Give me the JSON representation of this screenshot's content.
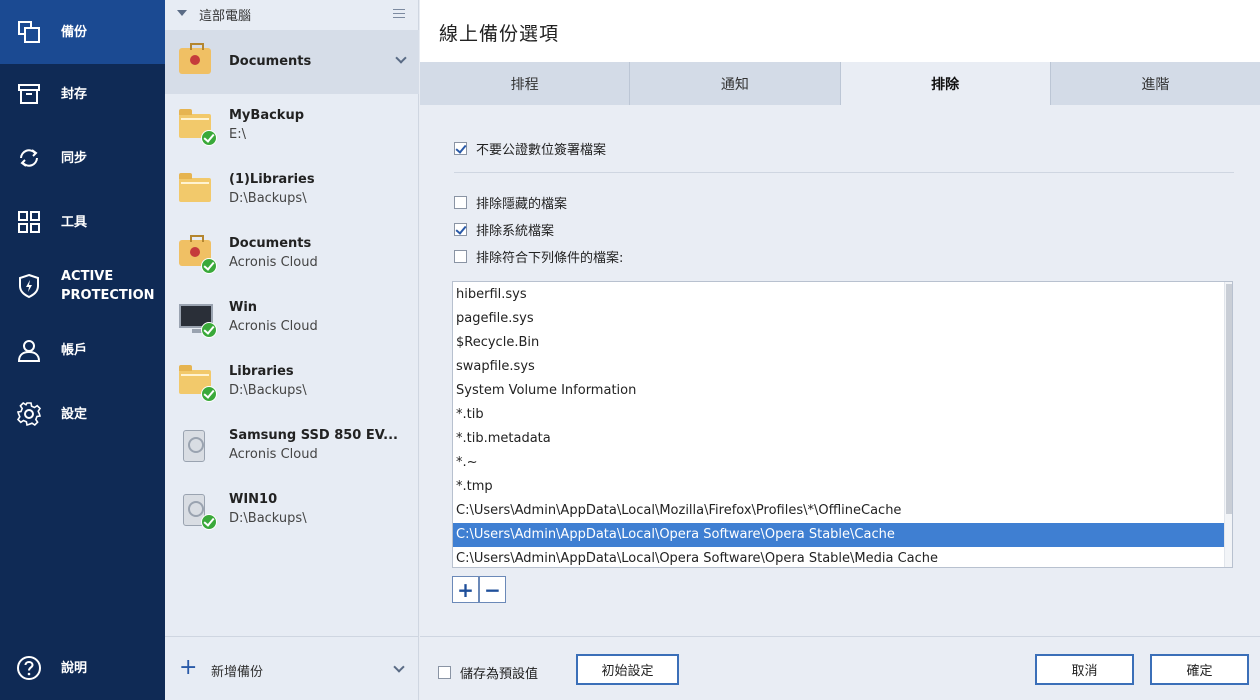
{
  "nav": {
    "items": [
      {
        "label": "備份",
        "icon": "backup-icon",
        "active": true
      },
      {
        "label": "封存",
        "icon": "archive-icon",
        "active": false
      },
      {
        "label": "同步",
        "icon": "sync-icon",
        "active": false
      },
      {
        "label": "工具",
        "icon": "tools-icon",
        "active": false
      },
      {
        "label": "ACTIVE PROTECTION",
        "icon": "shield-icon",
        "active": false
      },
      {
        "label": "帳戶",
        "icon": "account-icon",
        "active": false
      },
      {
        "label": "設定",
        "icon": "settings-icon",
        "active": false
      }
    ],
    "help": {
      "label": "說明",
      "icon": "help-icon"
    }
  },
  "backups": {
    "header": "這部電腦",
    "items": [
      {
        "name": "Documents",
        "sub": "",
        "icon": "briefcase-icon",
        "selected": true
      },
      {
        "name": "MyBackup",
        "sub": "E:\\",
        "icon": "folder-icon"
      },
      {
        "name": "(1)Libraries",
        "sub": "D:\\Backups\\",
        "icon": "folder-icon"
      },
      {
        "name": "Documents",
        "sub": "Acronis Cloud",
        "icon": "briefcase-icon"
      },
      {
        "name": "Win",
        "sub": "Acronis Cloud",
        "icon": "monitor-icon"
      },
      {
        "name": "Libraries",
        "sub": "D:\\Backups\\",
        "icon": "folder-icon"
      },
      {
        "name": "Samsung SSD 850 EV...",
        "sub": "Acronis Cloud",
        "icon": "drive-icon"
      },
      {
        "name": "WIN10",
        "sub": "D:\\Backups\\",
        "icon": "drive-icon"
      }
    ],
    "add_label": "新增備份"
  },
  "panel": {
    "title": "線上備份選項",
    "tabs": [
      "排程",
      "通知",
      "排除",
      "進階"
    ],
    "active_tab": 2,
    "options": {
      "no_sign": {
        "label": "不要公證數位簽署檔案",
        "checked": true
      },
      "hidden": {
        "label": "排除隱藏的檔案",
        "checked": false
      },
      "system": {
        "label": "排除系統檔案",
        "checked": true
      },
      "criteria": {
        "label": "排除符合下列條件的檔案:",
        "checked": false
      }
    },
    "exclusions": [
      "hiberfil.sys",
      "pagefile.sys",
      "$Recycle.Bin",
      "swapfile.sys",
      "System Volume Information",
      "*.tib",
      "*.tib.metadata",
      "*.~",
      "*.tmp",
      "C:\\Users\\Admin\\AppData\\Local\\Mozilla\\Firefox\\Profiles\\*\\OfflineCache",
      "C:\\Users\\Admin\\AppData\\Local\\Opera Software\\Opera Stable\\Cache",
      "C:\\Users\\Admin\\AppData\\Local\\Opera Software\\Opera Stable\\Media Cache"
    ],
    "selected_exclusion": 10,
    "add_symbol": "+",
    "remove_symbol": "−"
  },
  "footer": {
    "save_default": {
      "label": "儲存為預設值",
      "checked": false
    },
    "reset_label": "初始設定",
    "cancel_label": "取消",
    "ok_label": "確定"
  },
  "colors": {
    "nav_bg": "#0f2a55",
    "nav_active": "#1b4a92",
    "accent": "#3b6fb8",
    "selection": "#3f7fd2",
    "ok_green": "#3aa93a"
  }
}
